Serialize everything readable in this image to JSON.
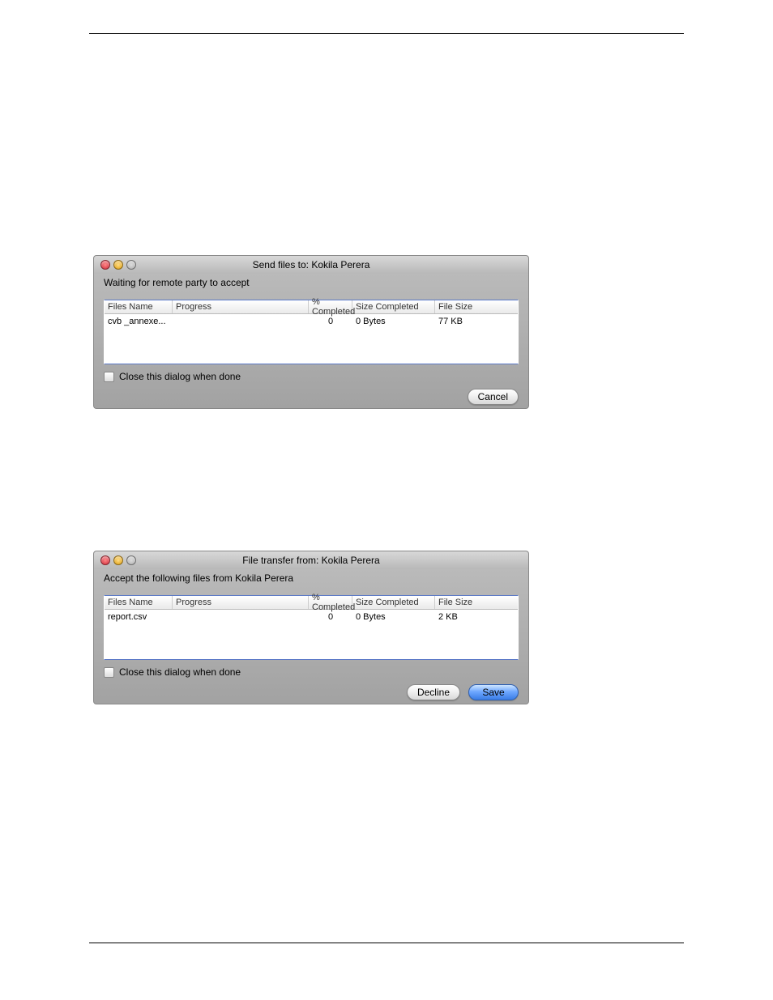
{
  "dialog1": {
    "title": "Send files to:  Kokila Perera",
    "status": "Waiting for remote party to accept",
    "columns": {
      "files_name": "Files Name",
      "progress": "Progress",
      "pct_completed": "% Completed",
      "size_completed": "Size Completed",
      "file_size": "File Size"
    },
    "rows": [
      {
        "file_name": "cvb _annexe...",
        "pct": "0",
        "size_completed": "0 Bytes",
        "file_size": "77 KB"
      }
    ],
    "checkbox_label": "Close this dialog when done",
    "checkbox_checked": false,
    "buttons": {
      "cancel": "Cancel"
    }
  },
  "dialog2": {
    "title": "File transfer from:  Kokila Perera",
    "status": "Accept the following files from  Kokila Perera",
    "columns": {
      "files_name": "Files Name",
      "progress": "Progress",
      "pct_completed": "% Completed",
      "size_completed": "Size Completed",
      "file_size": "File Size"
    },
    "rows": [
      {
        "file_name": "report.csv",
        "pct": "0",
        "size_completed": "0 Bytes",
        "file_size": "2 KB"
      }
    ],
    "checkbox_label": "Close this dialog when done",
    "checkbox_checked": false,
    "buttons": {
      "decline": "Decline",
      "save": "Save"
    }
  }
}
